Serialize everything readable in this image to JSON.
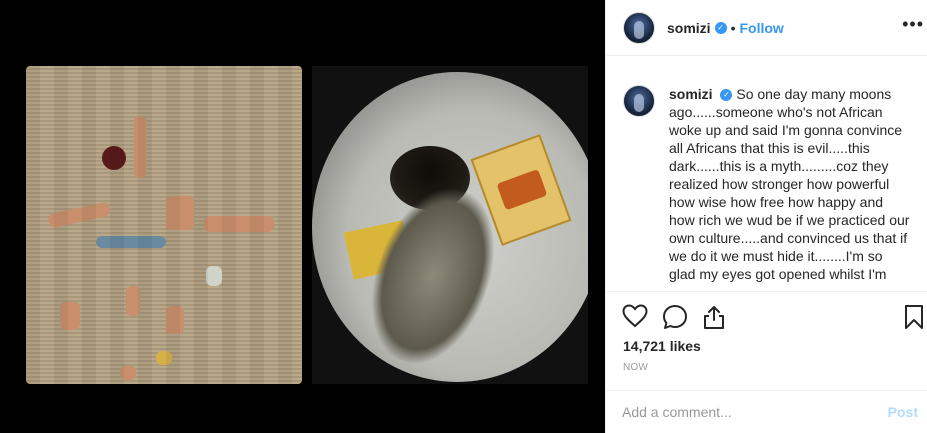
{
  "post": {
    "username": "somizi",
    "verified": true,
    "separator": "•",
    "follow_label": "Follow",
    "more_label": "•••"
  },
  "caption": {
    "username": "somizi",
    "text": "So one day many moons ago......someone who's not African woke up and said I'm gonna convince all Africans that this is evil.....this dark......this is a myth.........coz they realized how stronger how powerful how wise how free how happy and how rich we wud be if we practiced our own culture.....and convinced us that if we do it we must hide it........I'm so glad my eyes got opened whilst I'm"
  },
  "engagement": {
    "likes": "14,721 likes",
    "timestamp": "NOW"
  },
  "comment_box": {
    "placeholder": "Add a comment...",
    "post_label": "Post"
  },
  "icons": {
    "like": "heart-icon",
    "comment": "comment-icon",
    "share": "share-icon",
    "save": "bookmark-icon",
    "verified": "verified-badge-icon"
  },
  "colors": {
    "accent": "#3897f0",
    "post_disabled": "#b3dbff",
    "border": "#efefef",
    "muted": "#999999"
  }
}
